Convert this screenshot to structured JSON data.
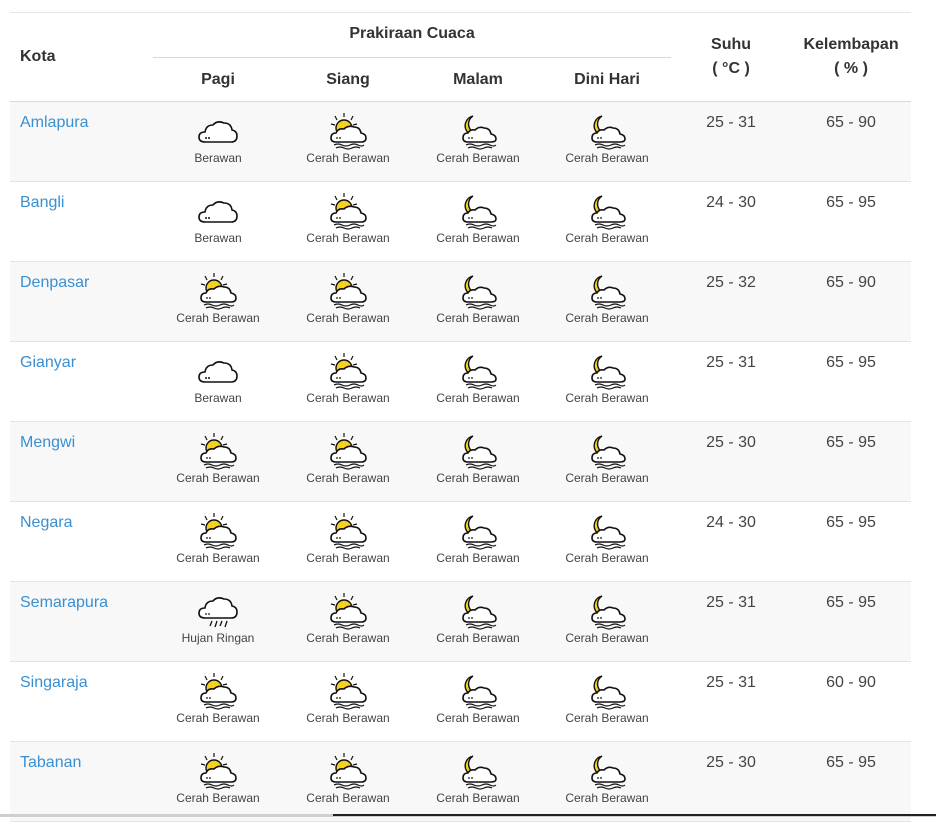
{
  "table": {
    "headers": {
      "kota": "Kota",
      "forecast_group": "Prakiraan Cuaca",
      "periods": [
        "Pagi",
        "Siang",
        "Malam",
        "Dini Hari"
      ],
      "suhu_line1": "Suhu",
      "suhu_line2": "( °C )",
      "kelembapan_line1": "Kelembapan",
      "kelembapan_line2": "( % )"
    },
    "rows": [
      {
        "city": "Amlapura",
        "forecast": [
          {
            "icon": "cloudy-icon",
            "label": "Berawan"
          },
          {
            "icon": "partly-cloudy-day-icon",
            "label": "Cerah Berawan"
          },
          {
            "icon": "partly-cloudy-night-icon",
            "label": "Cerah Berawan"
          },
          {
            "icon": "partly-cloudy-night-icon",
            "label": "Cerah Berawan"
          }
        ],
        "suhu": "25 - 31",
        "kelembapan": "65 - 90"
      },
      {
        "city": "Bangli",
        "forecast": [
          {
            "icon": "cloudy-icon",
            "label": "Berawan"
          },
          {
            "icon": "partly-cloudy-day-icon",
            "label": "Cerah Berawan"
          },
          {
            "icon": "partly-cloudy-night-icon",
            "label": "Cerah Berawan"
          },
          {
            "icon": "partly-cloudy-night-icon",
            "label": "Cerah Berawan"
          }
        ],
        "suhu": "24 - 30",
        "kelembapan": "65 - 95"
      },
      {
        "city": "Denpasar",
        "forecast": [
          {
            "icon": "partly-cloudy-day-icon",
            "label": "Cerah Berawan"
          },
          {
            "icon": "partly-cloudy-day-icon",
            "label": "Cerah Berawan"
          },
          {
            "icon": "partly-cloudy-night-icon",
            "label": "Cerah Berawan"
          },
          {
            "icon": "partly-cloudy-night-icon",
            "label": "Cerah Berawan"
          }
        ],
        "suhu": "25 - 32",
        "kelembapan": "65 - 90"
      },
      {
        "city": "Gianyar",
        "forecast": [
          {
            "icon": "cloudy-icon",
            "label": "Berawan"
          },
          {
            "icon": "partly-cloudy-day-icon",
            "label": "Cerah Berawan"
          },
          {
            "icon": "partly-cloudy-night-icon",
            "label": "Cerah Berawan"
          },
          {
            "icon": "partly-cloudy-night-icon",
            "label": "Cerah Berawan"
          }
        ],
        "suhu": "25 - 31",
        "kelembapan": "65 - 95"
      },
      {
        "city": "Mengwi",
        "forecast": [
          {
            "icon": "partly-cloudy-day-icon",
            "label": "Cerah Berawan"
          },
          {
            "icon": "partly-cloudy-day-icon",
            "label": "Cerah Berawan"
          },
          {
            "icon": "partly-cloudy-night-icon",
            "label": "Cerah Berawan"
          },
          {
            "icon": "partly-cloudy-night-icon",
            "label": "Cerah Berawan"
          }
        ],
        "suhu": "25 - 30",
        "kelembapan": "65 - 95"
      },
      {
        "city": "Negara",
        "forecast": [
          {
            "icon": "partly-cloudy-day-icon",
            "label": "Cerah Berawan"
          },
          {
            "icon": "partly-cloudy-day-icon",
            "label": "Cerah Berawan"
          },
          {
            "icon": "partly-cloudy-night-icon",
            "label": "Cerah Berawan"
          },
          {
            "icon": "partly-cloudy-night-icon",
            "label": "Cerah Berawan"
          }
        ],
        "suhu": "24 - 30",
        "kelembapan": "65 - 95"
      },
      {
        "city": "Semarapura",
        "forecast": [
          {
            "icon": "light-rain-icon",
            "label": "Hujan Ringan"
          },
          {
            "icon": "partly-cloudy-day-icon",
            "label": "Cerah Berawan"
          },
          {
            "icon": "partly-cloudy-night-icon",
            "label": "Cerah Berawan"
          },
          {
            "icon": "partly-cloudy-night-icon",
            "label": "Cerah Berawan"
          }
        ],
        "suhu": "25 - 31",
        "kelembapan": "65 - 95"
      },
      {
        "city": "Singaraja",
        "forecast": [
          {
            "icon": "partly-cloudy-day-icon",
            "label": "Cerah Berawan"
          },
          {
            "icon": "partly-cloudy-day-icon",
            "label": "Cerah Berawan"
          },
          {
            "icon": "partly-cloudy-night-icon",
            "label": "Cerah Berawan"
          },
          {
            "icon": "partly-cloudy-night-icon",
            "label": "Cerah Berawan"
          }
        ],
        "suhu": "25 - 31",
        "kelembapan": "60 - 90"
      },
      {
        "city": "Tabanan",
        "forecast": [
          {
            "icon": "partly-cloudy-day-icon",
            "label": "Cerah Berawan"
          },
          {
            "icon": "partly-cloudy-day-icon",
            "label": "Cerah Berawan"
          },
          {
            "icon": "partly-cloudy-night-icon",
            "label": "Cerah Berawan"
          },
          {
            "icon": "partly-cloudy-night-icon",
            "label": "Cerah Berawan"
          }
        ],
        "suhu": "25 - 30",
        "kelembapan": "65 - 95"
      }
    ]
  },
  "colors": {
    "city_link": "#3a8fd0",
    "sun": "#f6d21e",
    "moon": "#f6d21e",
    "row_alt": "#f8f8f8"
  }
}
